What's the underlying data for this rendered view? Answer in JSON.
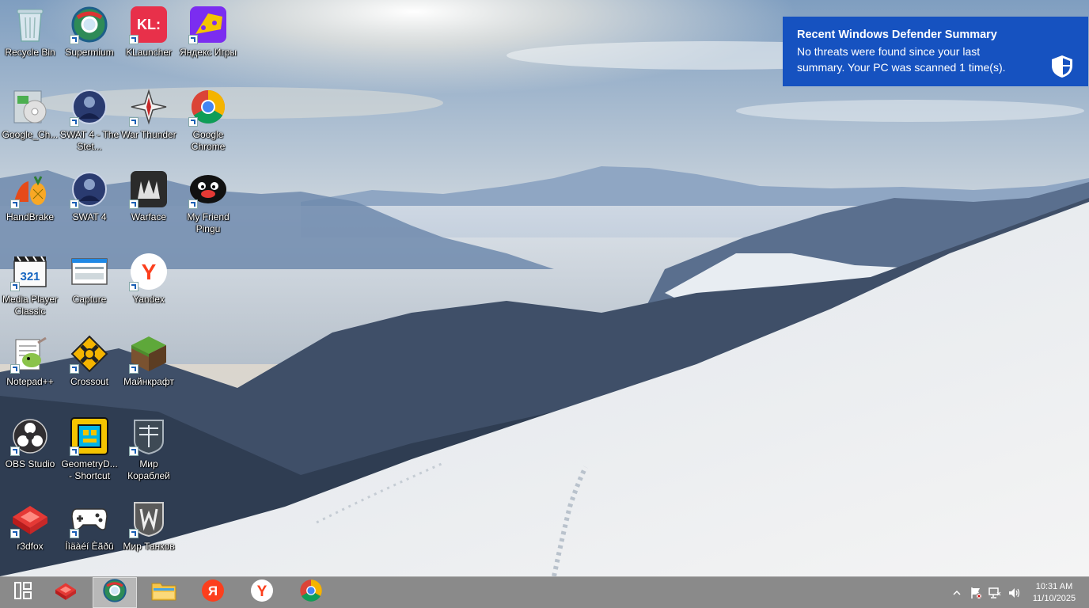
{
  "desktop": {
    "icons": [
      {
        "label": "Recycle Bin"
      },
      {
        "label": "Supermium"
      },
      {
        "label": "KLauncher"
      },
      {
        "label": "Яндекс Игры"
      },
      {
        "label": "Google_Ch..."
      },
      {
        "label": "SWAT 4 - The Stet..."
      },
      {
        "label": "War Thunder"
      },
      {
        "label": "Google Chrome"
      },
      {
        "label": "HandBrake"
      },
      {
        "label": "SWAT 4"
      },
      {
        "label": "Warface"
      },
      {
        "label": "My Friend Pingu"
      },
      {
        "label": "Media Player Classic"
      },
      {
        "label": "Capture"
      },
      {
        "label": "Yandex"
      },
      {
        "label": "Notepad++"
      },
      {
        "label": "Crossout"
      },
      {
        "label": "Майнкрафт"
      },
      {
        "label": "OBS Studio"
      },
      {
        "label": "GeometryD... - Shortcut"
      },
      {
        "label": "Мир Кораблей"
      },
      {
        "label": "r3dfox"
      },
      {
        "label": "Íìäàéí Èãðû"
      },
      {
        "label": "Мир Танков"
      }
    ]
  },
  "notification": {
    "title": "Recent Windows Defender Summary",
    "body": "No threats were found since your last summary. Your PC was scanned 1 time(s).",
    "icon": "defender-shield-icon",
    "accent": "#1652c0"
  },
  "taskbar": {
    "buttons": [
      {
        "icon": "start-icon"
      },
      {
        "icon": "r3dfox-icon"
      },
      {
        "icon": "supermium-icon",
        "active": true
      },
      {
        "icon": "file-explorer-icon"
      },
      {
        "icon": "yandex-browser-icon"
      },
      {
        "icon": "yandex-icon"
      },
      {
        "icon": "chrome-icon"
      }
    ],
    "tray": {
      "icons": [
        "show-hidden-icons-chevron",
        "action-center-flag-icon",
        "network-icon",
        "volume-icon"
      ],
      "time": "10:31 AM",
      "date": "11/10/2025"
    }
  }
}
